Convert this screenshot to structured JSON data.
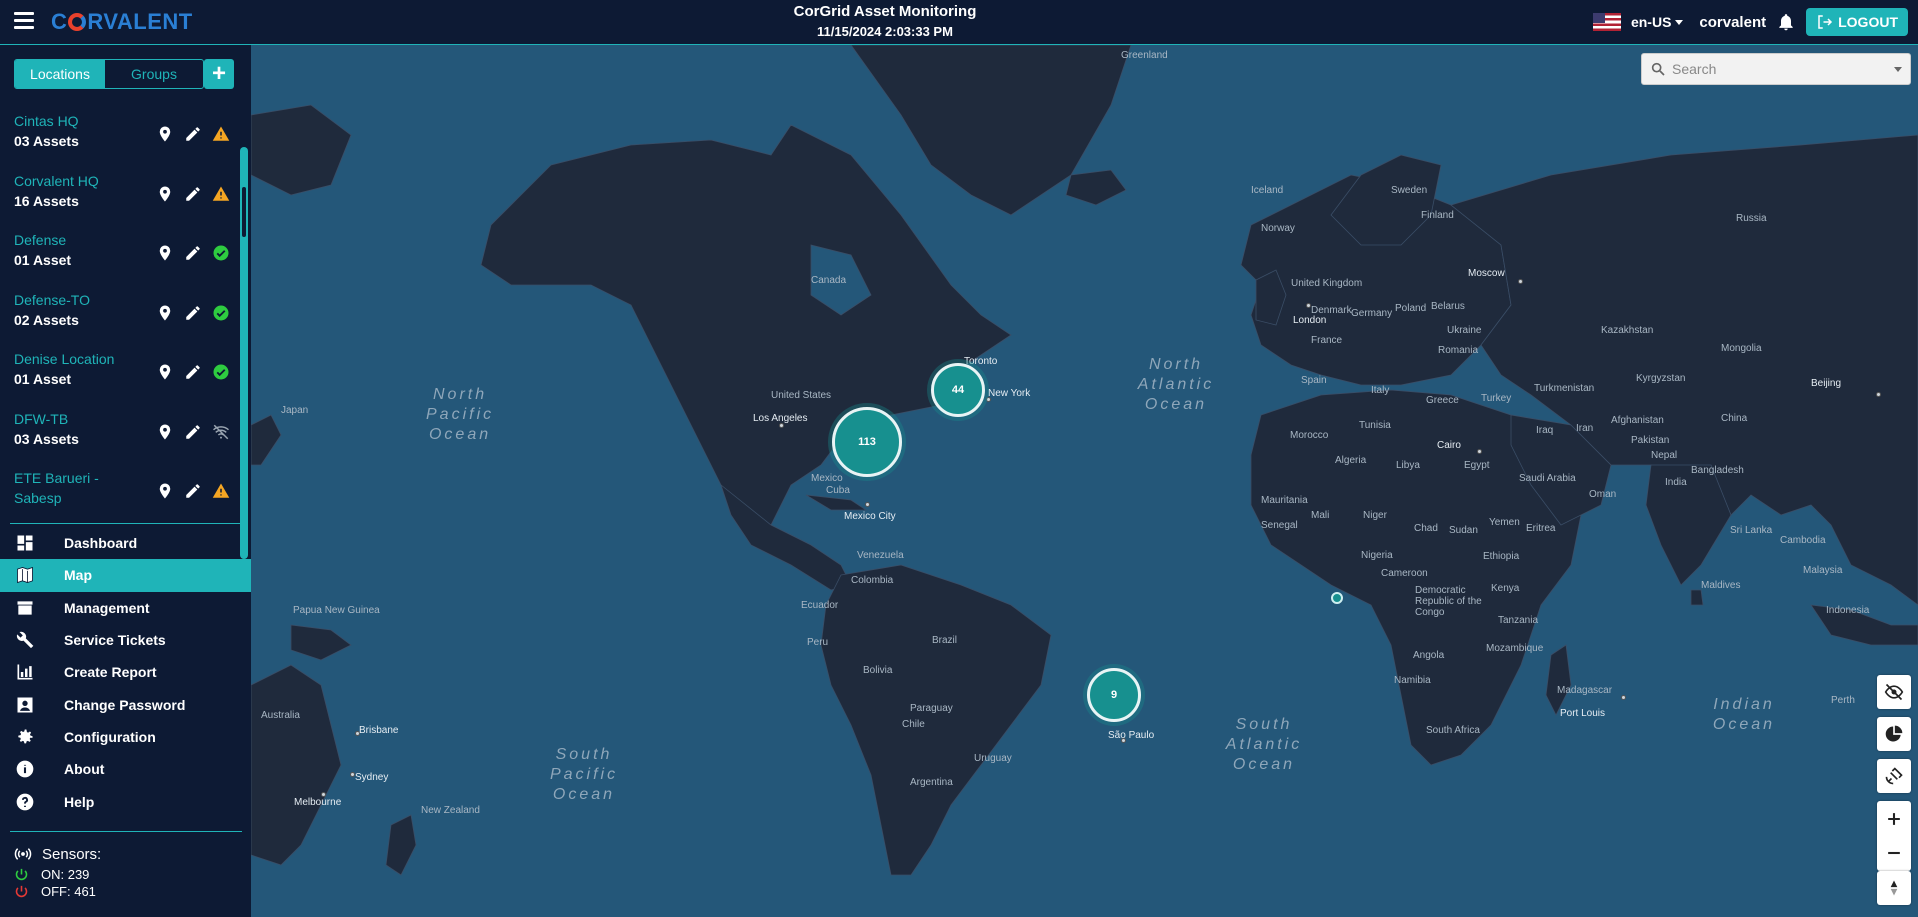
{
  "header": {
    "brand": "CORVALENT",
    "title": "CorGrid Asset Monitoring",
    "datetime": "11/15/2024 2:03:33 PM",
    "language": "en-US",
    "username": "corvalent",
    "logout_label": "LOGOUT"
  },
  "sidebar": {
    "tabs": [
      {
        "label": "Locations",
        "active": true
      },
      {
        "label": "Groups",
        "active": false
      }
    ],
    "add_label": "+",
    "locations": [
      {
        "name": "Cintas HQ",
        "assets": "03 Assets",
        "status": "warning"
      },
      {
        "name": "Corvalent HQ",
        "assets": "16 Assets",
        "status": "warning"
      },
      {
        "name": "Defense",
        "assets": "01 Asset",
        "status": "ok"
      },
      {
        "name": "Defense-TO",
        "assets": "02 Assets",
        "status": "ok"
      },
      {
        "name": "Denise Location",
        "assets": "01 Asset",
        "status": "ok"
      },
      {
        "name": "DFW-TB",
        "assets": "03 Assets",
        "status": "offline"
      },
      {
        "name": "ETE Barueri - Sabesp",
        "assets": "",
        "status": "warning"
      }
    ],
    "nav": [
      {
        "label": "Dashboard",
        "icon": "dashboard-icon",
        "active": false
      },
      {
        "label": "Map",
        "icon": "map-icon",
        "active": true
      },
      {
        "label": "Management",
        "icon": "archive-icon",
        "active": false
      },
      {
        "label": "Service Tickets",
        "icon": "wrench-icon",
        "active": false
      },
      {
        "label": "Create Report",
        "icon": "report-icon",
        "active": false
      },
      {
        "label": "Change Password",
        "icon": "account-icon",
        "active": false
      },
      {
        "label": "Configuration",
        "icon": "gear-icon",
        "active": false
      },
      {
        "label": "About",
        "icon": "info-icon",
        "active": false
      },
      {
        "label": "Help",
        "icon": "help-icon",
        "active": false
      }
    ],
    "sensors": {
      "title": "Sensors:",
      "on": "ON: 239",
      "off": "OFF: 461"
    }
  },
  "map": {
    "search_placeholder": "Search",
    "clusters": [
      {
        "label": "44"
      },
      {
        "label": "113"
      },
      {
        "label": "9"
      }
    ],
    "cities": [
      "Toronto",
      "New York",
      "Los Angeles",
      "Mexico City",
      "London",
      "Moscow",
      "Cairo",
      "Beijing",
      "Brisbane",
      "Sydney",
      "Melbourne",
      "São Paulo",
      "Port Louis"
    ],
    "countries": [
      "Greenland",
      "Iceland",
      "Sweden",
      "Finland",
      "Norway",
      "Russia",
      "Canada",
      "United States",
      "United Kingdom",
      "Denmark",
      "Germany",
      "Poland",
      "Belarus",
      "Ukraine",
      "France",
      "Romania",
      "Kazakhstan",
      "Mongolia",
      "Spain",
      "Italy",
      "Greece",
      "Turkey",
      "Turkmenistan",
      "Kyrgyzstan",
      "China",
      "Iran",
      "Iraq",
      "Afghanistan",
      "Pakistan",
      "Nepal",
      "India",
      "Bangladesh",
      "Morocco",
      "Algeria",
      "Libya",
      "Egypt",
      "Saudi Arabia",
      "Oman",
      "Tunisia",
      "Japan",
      "Mauritania",
      "Mali",
      "Niger",
      "Chad",
      "Sudan",
      "Eritrea",
      "Yemen",
      "Senegal",
      "Nigeria",
      "Ethiopia",
      "Cameroon",
      "Democratic Republic of the Congo",
      "Kenya",
      "Tanzania",
      "Angola",
      "Mozambique",
      "Namibia",
      "Madagascar",
      "South Africa",
      "Cuba",
      "Mexico",
      "Venezuela",
      "Colombia",
      "Ecuador",
      "Peru",
      "Brazil",
      "Bolivia",
      "Paraguay",
      "Chile",
      "Uruguay",
      "Argentina",
      "Papua New Guinea",
      "Australia",
      "New Zealand",
      "Sri Lanka",
      "Maldives",
      "Malaysia",
      "Cambodia",
      "Indonesia",
      "Perth"
    ],
    "oceans": [
      "North Pacific Ocean",
      "North Atlantic Ocean",
      "South Pacific Ocean",
      "South Atlantic Ocean",
      "Indian Ocean"
    ],
    "controls": [
      "hide-icon",
      "pie-chart-icon",
      "satellite-icon",
      "zoom-in-icon",
      "zoom-out-icon",
      "compass-icon"
    ]
  }
}
